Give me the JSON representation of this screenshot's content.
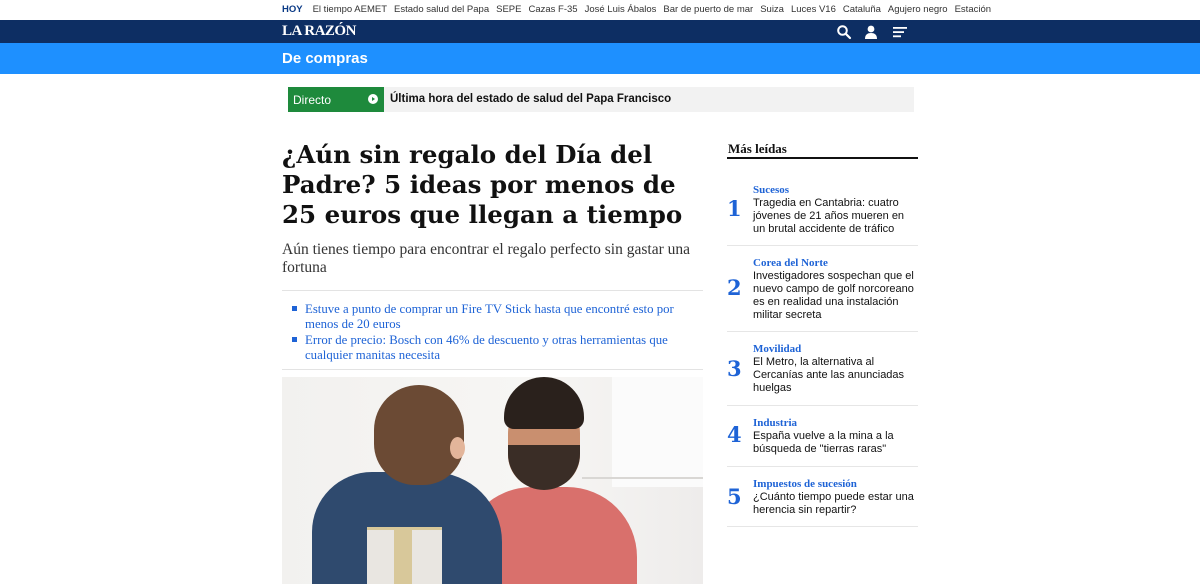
{
  "trending": {
    "label": "HOY",
    "items": [
      "El tiempo AEMET",
      "Estado salud del Papa",
      "SEPE",
      "Cazas F-35",
      "José Luis Ábalos",
      "Bar de puerto de mar",
      "Suiza",
      "Luces V16",
      "Cataluña",
      "Agujero negro",
      "Estación"
    ]
  },
  "header": {
    "logo": "LA RAZÓN",
    "icons": [
      "search-icon",
      "user-icon",
      "menu-icon"
    ],
    "color": "#0d2e63"
  },
  "section": {
    "title": "De compras",
    "color": "#1e90ff"
  },
  "live": {
    "tag": "Directo",
    "text": "Última hora del estado de salud del Papa Francisco",
    "tag_color": "#1e8a3c"
  },
  "article": {
    "headline": "¿Aún sin regalo del Día del Padre? 5 ideas por menos de 25 euros que llegan a tiempo",
    "subhead": "Aún tienes tiempo para encontrar el regalo perfecto sin gastar una fortuna",
    "related": [
      "Estuve a punto de comprar un Fire TV Stick hasta que encontré esto por menos de 20 euros",
      "Error de precio: Bosch con 46% de descuento y otras herramientas que cualquier manitas necesita"
    ],
    "link_color": "#1e63d6"
  },
  "sidebar": {
    "title": "Más leídas",
    "items": [
      {
        "num": "1",
        "category": "Sucesos",
        "headline": "Tragedia en Cantabria: cuatro jóvenes de 21 años mueren en un brutal accidente de tráfico"
      },
      {
        "num": "2",
        "category": "Corea del Norte",
        "headline": "Investigadores sospechan que el nuevo campo de golf norcoreano es en realidad una instalación militar secreta"
      },
      {
        "num": "3",
        "category": "Movilidad",
        "headline": "El Metro, la alternativa al Cercanías ante las anunciadas huelgas"
      },
      {
        "num": "4",
        "category": "Industria",
        "headline": "España vuelve a la mina a la búsqueda de \"tierras raras\""
      },
      {
        "num": "5",
        "category": "Impuestos de sucesión",
        "headline": "¿Cuánto tiempo puede estar una herencia sin repartir?"
      }
    ]
  }
}
